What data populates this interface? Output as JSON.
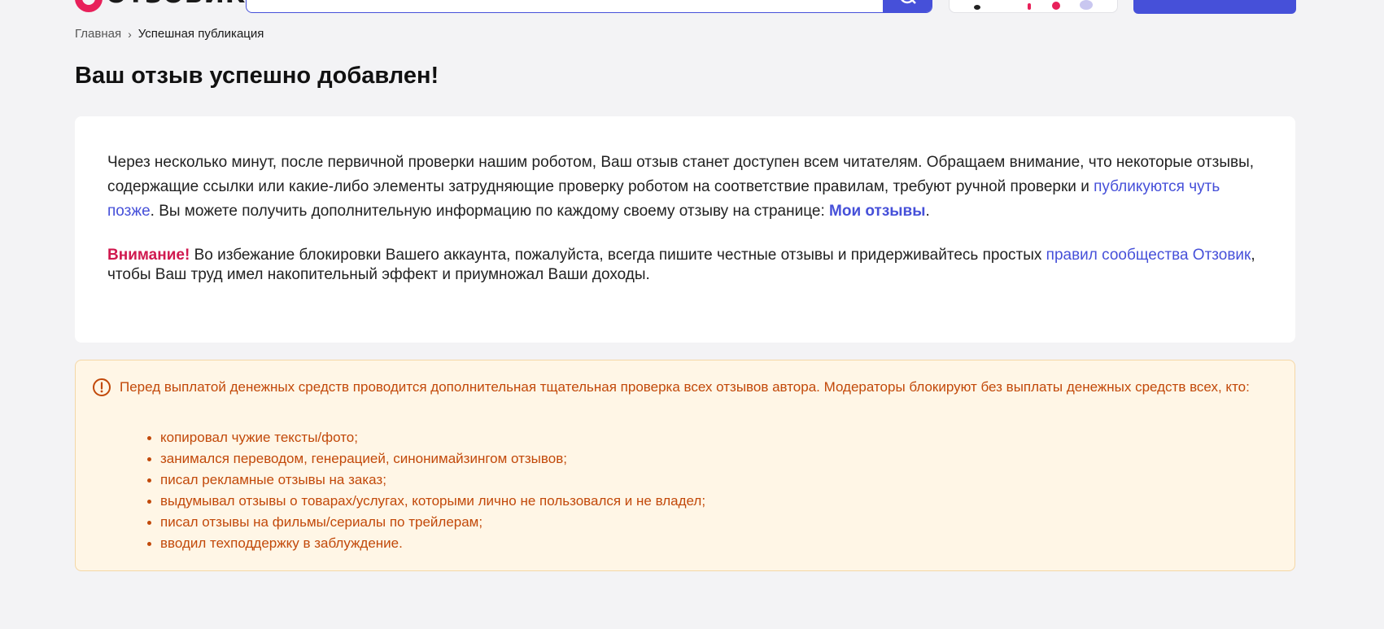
{
  "header": {
    "logo_text": "ОТЗОВИК",
    "search_placeholder": ""
  },
  "breadcrumb": {
    "home": "Главная",
    "separator": "›",
    "current": "Успешная публикация"
  },
  "page_title": "Ваш отзыв успешно добавлен!",
  "info": {
    "text_before_link": "Через несколько минут, после первичной проверки нашим роботом, Ваш отзыв станет доступен всем читателям. Обращаем внимание, что некоторые отзывы, содержащие ссылки или какие-либо элементы затрудняющие проверку роботом на соответствие правилам, требуют ручной проверки и ",
    "later_link": "публикуются чуть позже",
    "text_after_link": ". Вы можете получить дополнительную информацию по каждому своему отзыву на странице: ",
    "my_reviews_link": "Мои отзывы",
    "period": "."
  },
  "notice": {
    "label": "Внимание!",
    "text": " Во избежание блокировки Вашего аккаунта, пожалуйста, всегда пишите честные отзывы и придерживайтесь простых ",
    "rules_link": "правил сообщества Отзовик",
    "text_end": ", чтобы Ваш труд имел накопительный эффект и приумножал Ваши доходы."
  },
  "alert": {
    "text": "Перед выплатой денежных средств проводится дополнительная тщательная проверка всех отзывов автора. Модераторы блокируют без выплаты денежных средств всех, кто:",
    "items": [
      "копировал чужие тексты/фото;",
      "занимался переводом, генерацией, синонимайзингом отзывов;",
      "писал рекламные отзывы на заказ;",
      "выдумывал отзывы о товарах/услугах, которыми лично не пользовался и не владел;",
      "писал отзывы на фильмы/сериалы по трейлерам;",
      "вводил техподдержку в заблуждение."
    ]
  },
  "colors": {
    "accent": "#4650d9",
    "brand": "#e8205a",
    "warning_text": "#c2490a",
    "warning_bg": "#fff6e6",
    "attention": "#d0194f"
  }
}
